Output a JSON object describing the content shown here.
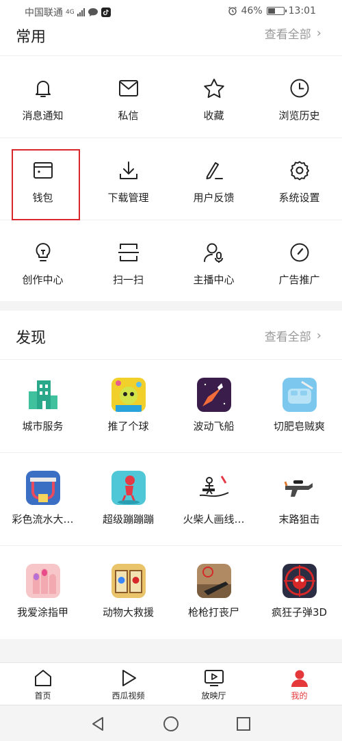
{
  "status_bar": {
    "carrier": "中国联通",
    "network": "4G",
    "battery_percent": "46%",
    "battery_level": 0.46,
    "time": "13:01"
  },
  "common": {
    "title": "常用",
    "see_all": "查看全部",
    "items": [
      {
        "label": "消息通知",
        "icon": "bell-icon"
      },
      {
        "label": "私信",
        "icon": "mail-icon"
      },
      {
        "label": "收藏",
        "icon": "star-icon"
      },
      {
        "label": "浏览历史",
        "icon": "clock-icon"
      },
      {
        "label": "钱包",
        "icon": "wallet-icon"
      },
      {
        "label": "下载管理",
        "icon": "download-icon"
      },
      {
        "label": "用户反馈",
        "icon": "feedback-pen-icon"
      },
      {
        "label": "系统设置",
        "icon": "gear-icon"
      },
      {
        "label": "创作中心",
        "icon": "lightbulb-icon"
      },
      {
        "label": "扫一扫",
        "icon": "scan-icon"
      },
      {
        "label": "主播中心",
        "icon": "streamer-icon"
      },
      {
        "label": "广告推广",
        "icon": "gauge-icon"
      }
    ]
  },
  "discover": {
    "title": "发现",
    "see_all": "查看全部",
    "items": [
      {
        "label": "城市服务",
        "icon": "city-building-icon",
        "color": "#2aa88a"
      },
      {
        "label": "推了个球",
        "icon": "ball-game-icon",
        "color": "#f2d02b"
      },
      {
        "label": "波动飞船",
        "icon": "rocket-game-icon",
        "color": "#3a1d4a"
      },
      {
        "label": "切肥皂贼爽",
        "icon": "soap-game-icon",
        "color": "#7cc7ee"
      },
      {
        "label": "彩色流水大…",
        "icon": "color-water-game-icon",
        "color": "#3b6fc4"
      },
      {
        "label": "超级蹦蹦蹦",
        "icon": "jump-game-icon",
        "color": "#4fc7d6"
      },
      {
        "label": "火柴人画线…",
        "icon": "stickman-game-icon",
        "color": "#f2f2f2"
      },
      {
        "label": "末路狙击",
        "icon": "sniper-rifle-icon",
        "color": "#ffffff"
      },
      {
        "label": "我爱涂指甲",
        "icon": "nail-game-icon",
        "color": "#f6c6c8"
      },
      {
        "label": "动物大救援",
        "icon": "animal-rescue-game-icon",
        "color": "#e9c46a"
      },
      {
        "label": "枪枪打丧尸",
        "icon": "zombie-shooter-game-icon",
        "color": "#b08a63"
      },
      {
        "label": "疯狂子弹3D",
        "icon": "crazy-bullet-game-icon",
        "color": "#d62828"
      }
    ]
  },
  "tabbar": [
    {
      "label": "首页",
      "icon": "home-icon"
    },
    {
      "label": "西瓜视频",
      "icon": "play-icon"
    },
    {
      "label": "放映厅",
      "icon": "tv-play-icon"
    },
    {
      "label": "我的",
      "icon": "profile-icon",
      "active": true
    }
  ],
  "colors": {
    "accent": "#e5383b",
    "highlight_border": "#d9252c"
  }
}
